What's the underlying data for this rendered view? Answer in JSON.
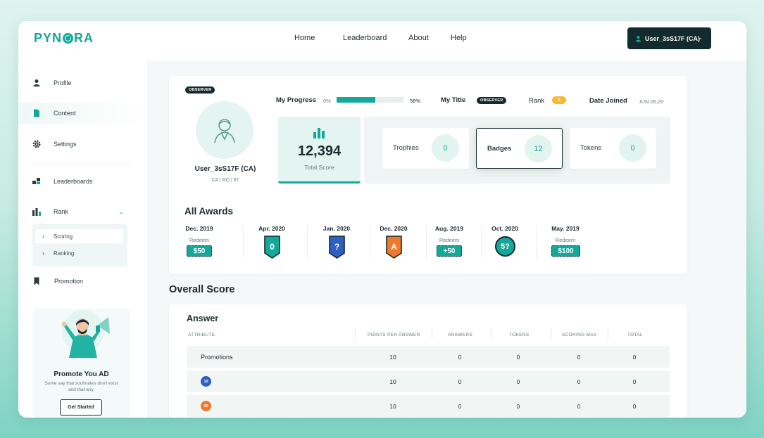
{
  "app": {
    "logo": "PYNORA"
  },
  "nav": {
    "home": "Home",
    "leaderboard": "Leaderboard",
    "about": "About",
    "help": "Help"
  },
  "user_menu": {
    "label": "User_3sS17F (CA)"
  },
  "sidebar": {
    "items": [
      {
        "label": "Profile",
        "icon": "person-icon"
      },
      {
        "label": "Content",
        "icon": "document-icon"
      },
      {
        "label": "Settings",
        "icon": "gear-icon"
      },
      {
        "label": "Leaderboards",
        "icon": "grid-icon"
      },
      {
        "label": "Rank",
        "icon": "bar-chart-icon"
      },
      {
        "label": "Promotion",
        "icon": "bookmark-icon"
      }
    ],
    "rank_sub": [
      "Scoring",
      "Ranking"
    ],
    "promo": {
      "title": "Promote You AD",
      "text": "Some say that soulmates don't exist and that any.",
      "button": "Get Started"
    }
  },
  "profile": {
    "tag": "OBSERVER",
    "name": "User_3sS17F (CA)",
    "meta": "CA | RO | 87",
    "progress_label": "My Progress",
    "progress_min": "0%",
    "progress_value": "58%",
    "progress_fraction": 0.58,
    "title_label": "My Title",
    "title_value": "OBSERVER",
    "rank_label": "Rank",
    "rank_value": "0",
    "joined_label": "Date Joined",
    "joined_value": "JUN 06,20",
    "total_score": "12,394",
    "total_score_label": "Total Score",
    "stats": [
      {
        "label": "Trophies",
        "value": "0"
      },
      {
        "label": "Badges",
        "value": "12"
      },
      {
        "label": "Tokens",
        "value": "0"
      }
    ]
  },
  "awards": {
    "title": "All Awards",
    "items": [
      {
        "date": "Dec. 2019",
        "redeem": "Redeem",
        "value": "$50",
        "kind": "ticket"
      },
      {
        "date": "Apr. 2020",
        "value": "0",
        "kind": "shield",
        "color": "#13a89a"
      },
      {
        "date": "Jan. 2020",
        "value": "?",
        "kind": "shield",
        "color": "#2f5fc4"
      },
      {
        "date": "Dec. 2020",
        "value": "A",
        "kind": "shield",
        "color": "#f07a2a"
      },
      {
        "date": "Aug. 2019",
        "redeem": "Redeem",
        "value": "+50",
        "kind": "ticket"
      },
      {
        "date": "Oct. 2020",
        "value": "5?",
        "kind": "circle"
      },
      {
        "date": "May. 2019",
        "redeem": "Redeem",
        "value": "$100",
        "kind": "ticket"
      }
    ]
  },
  "overall": {
    "title": "Overall Score",
    "section": "Answer",
    "headers": [
      "ATTRIBUTE",
      "POINTS PER ANSWER",
      "ANSWERS",
      "TOKENS",
      "SCORING MAX",
      "TOTAL"
    ],
    "rows": [
      {
        "label": "Promotions",
        "cells": [
          "10",
          "0",
          "0",
          "0",
          "0"
        ]
      },
      {
        "badge": "10",
        "badge_color": "#2f5fc4",
        "cells": [
          "10",
          "0",
          "0",
          "0",
          "0"
        ]
      },
      {
        "badge": "50",
        "badge_color": "#f07a2a",
        "cells": [
          "10",
          "0",
          "0",
          "0",
          "0"
        ]
      }
    ]
  }
}
